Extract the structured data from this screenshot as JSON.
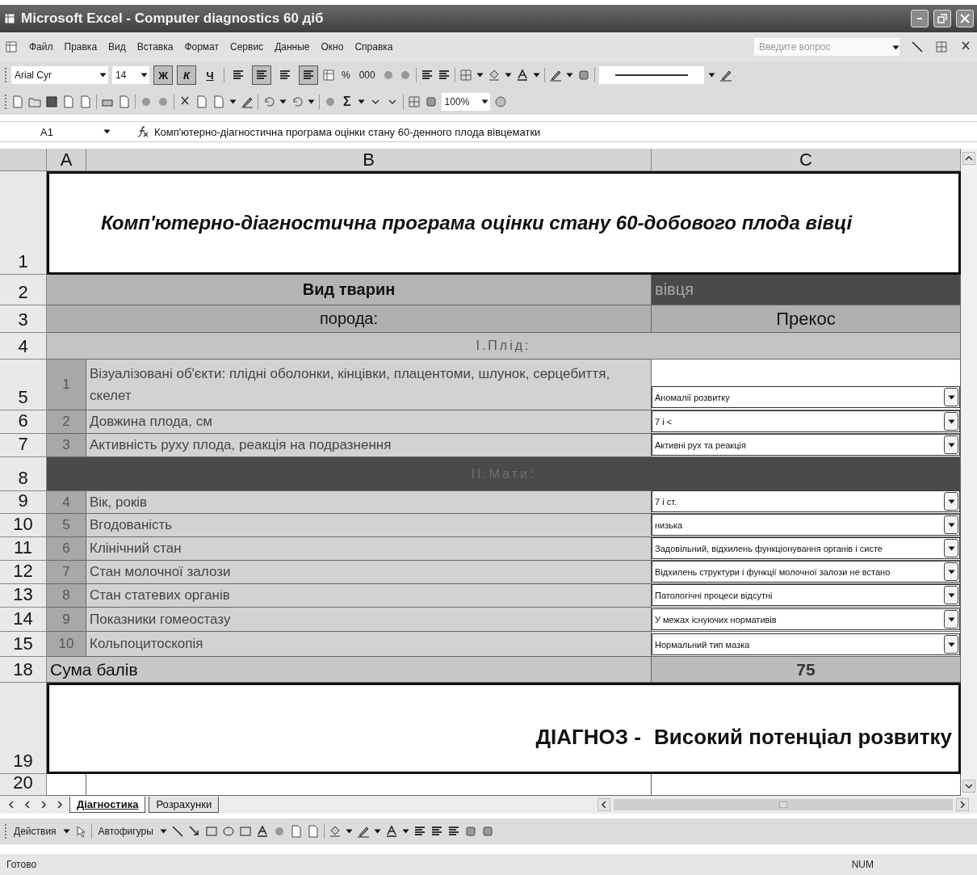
{
  "window": {
    "title": "Microsoft Excel - Computer diagnostics 60 дiб"
  },
  "menu": {
    "items": [
      "Файл",
      "Правка",
      "Вид",
      "Вставка",
      "Формат",
      "Сервис",
      "Данные",
      "Окно",
      "Справка"
    ],
    "help_placeholder": "Введите вопрос"
  },
  "format_toolbar": {
    "font": "Arial Cyr",
    "size": "14",
    "styles": [
      {
        "label": "Ж",
        "selected": true
      },
      {
        "label": "К",
        "selected": true
      },
      {
        "label": "Ч",
        "selected": false
      }
    ],
    "alignment": [
      {
        "selected": false
      },
      {
        "selected": true
      },
      {
        "selected": false
      },
      {
        "selected": true
      }
    ],
    "percent": "%",
    "thousands": "000"
  },
  "standard_toolbar": {
    "sum": "Σ",
    "zoom": "100%"
  },
  "formula_bar": {
    "cell": "A1",
    "content": "Комп'ютерно-діагностична програма оцінки стану 60-денного плода вівцематки"
  },
  "columns": [
    "A",
    "B",
    "C"
  ],
  "rows": [
    {
      "kind": "title",
      "row": "1",
      "text": "Комп'ютерно-діагностична програма оцінки стану 60-добового плода вівці"
    },
    {
      "kind": "species",
      "row": "2",
      "label": "Вид тварин",
      "value": "вівця"
    },
    {
      "kind": "breed",
      "row": "3",
      "label": "порода:",
      "value": "Прекос"
    },
    {
      "kind": "section",
      "row": "4",
      "text": "І.Плід:",
      "dark": false
    },
    {
      "kind": "item",
      "row": "5",
      "num": "1",
      "label": "Візуалізовані об'єкти: плідні оболонки, кінцівки, плацентоми, шлунок, серцебиття, скелет",
      "value": "Аномалії розвитку"
    },
    {
      "kind": "item",
      "row": "6",
      "num": "2",
      "label": "Довжина плода, см",
      "value": "7 і <"
    },
    {
      "kind": "item",
      "row": "7",
      "num": "3",
      "label": "Активність руху плода, реакція на подразнення",
      "value": "Активні рух та реакція"
    },
    {
      "kind": "section",
      "row": "8",
      "text": "ІІ.Мати:",
      "dark": true
    },
    {
      "kind": "item",
      "row": "9",
      "num": "4",
      "label": "Вік, років",
      "value": "7 і ст."
    },
    {
      "kind": "item",
      "row": "10",
      "num": "5",
      "label": "Вгодованість",
      "value": "низька"
    },
    {
      "kind": "item",
      "row": "11",
      "num": "6",
      "label": "Клінічний стан",
      "value": "Задовільний, відхилень функціонування органів і систе"
    },
    {
      "kind": "item",
      "row": "12",
      "num": "7",
      "label": "Стан молочної залози",
      "value": "Відхилень структури і функції молочної залози не встано"
    },
    {
      "kind": "item",
      "row": "13",
      "num": "8",
      "label": "Стан статевих органів",
      "value": "Патологічні процеси відсутні"
    },
    {
      "kind": "item",
      "row": "14",
      "num": "9",
      "label": "Показники гомеостазу",
      "value": "У межах існуючих нормативів"
    },
    {
      "kind": "item",
      "row": "15",
      "num": "10",
      "label": "Кольпоцитоскопія",
      "value": "Нормальний тип мазка"
    },
    {
      "kind": "total",
      "row": "18",
      "label": "Сума балів",
      "value": "75"
    },
    {
      "kind": "diagnosis",
      "row": "19",
      "label": "ДІАГНОЗ -",
      "value": "Високий потенціал розвитку"
    },
    {
      "kind": "empty",
      "row": "20"
    }
  ],
  "sheet_tabs": [
    {
      "label": "Діагностика",
      "selected": true
    },
    {
      "label": "Розрахунки",
      "selected": false
    }
  ],
  "drawing_toolbar": {
    "actions": "Действия",
    "autoshapes": "Автофигуры"
  },
  "status_bar": {
    "status": "Готово",
    "num": "NUM"
  }
}
